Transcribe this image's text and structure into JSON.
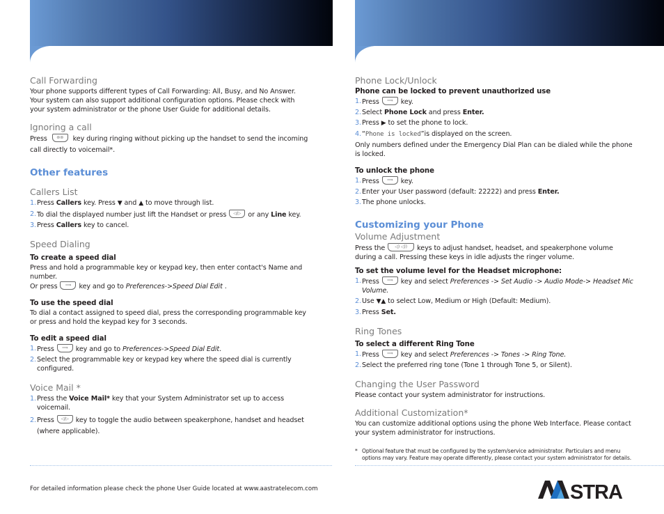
{
  "left_page": {
    "call_forwarding": {
      "heading": "Call Forwarding",
      "body": "Your phone supports different types of Call Forwarding: All, Busy, and No Answer. Your system can also support additional configuration options. Please check with your system administrator or the phone User Guide for additional details."
    },
    "ignoring_call": {
      "heading": "Ignoring a call",
      "pre": "Press",
      "post": "key during ringing without picking up the handset to send  the incoming call directly to voicemail*.",
      "key_icon": "voicemail-key-icon"
    },
    "other_features": {
      "title": "Other features",
      "callers_list": {
        "heading": "Callers List",
        "items": [
          {
            "num": "1.",
            "a": "Press ",
            "b": "Callers",
            "c": " key. Press ",
            "d": " and ",
            "e": " to move through list.",
            "down": "▼",
            "up": "▲"
          },
          {
            "num": "2.",
            "a": "To dial the displayed number just lift the Handset or press",
            "b": "or any ",
            "c": "Line",
            "d": " key."
          },
          {
            "num": "3.",
            "a": "Press ",
            "b": "Callers",
            "c": " key to cancel."
          }
        ]
      },
      "speed_dialing": {
        "heading": "Speed Dialing",
        "create": {
          "title": "To create a speed dial",
          "body": "Press and hold a programmable key or keypad key, then enter contact's Name and number.",
          "or_pre": "Or press",
          "or_mid": "key and go to ",
          "or_path": "Preferences->Speed Dial Edit",
          "or_end": " ."
        },
        "use": {
          "title": "To use the speed dial",
          "body": "To dial a contact assigned to speed dial, press the corresponding programmable key or press and hold the keypad key for 3 seconds."
        },
        "edit": {
          "title": "To edit a speed dial",
          "items": [
            {
              "num": "1.",
              "a": "Press",
              "b": "key and go to ",
              "c": "Preferences->Speed Dial Edit",
              "d": "."
            },
            {
              "num": "2.",
              "a": "Select the programmable key or  keypad key where the speed dial is currently configured."
            }
          ]
        }
      },
      "voice_mail": {
        "heading": "Voice Mail *",
        "items": [
          {
            "num": "1.",
            "a": "Press the ",
            "b": "Voice Mail*",
            "c": " key that your System Administrator set up to access voicemail."
          },
          {
            "num": "2.",
            "a": "Press",
            "b": "key to toggle the audio between speakerphone, handset and headset (where applicable)."
          }
        ]
      }
    },
    "footer": "For detailed information please check the phone User Guide located at www.aastratelecom.com"
  },
  "right_page": {
    "phone_lock": {
      "heading": "Phone Lock/Unlock",
      "lock_title": "Phone can be locked to prevent unauthorized use",
      "lock_items": [
        {
          "num": "1.",
          "a": "Press",
          "b": "key."
        },
        {
          "num": "2.",
          "a": "Select ",
          "b": "Phone Lock",
          "c": " and press ",
          "d": "Enter."
        },
        {
          "num": "3.",
          "a": "Press ",
          "b": "▶",
          "c": " to set the phone to lock."
        },
        {
          "num": "4.",
          "a": "“",
          "b": "Phone is locked",
          "c": "”is displayed on the screen."
        }
      ],
      "note": "Only numbers defined under the Emergency Dial Plan can be dialed while the phone is locked.",
      "unlock_title": "To unlock the phone",
      "unlock_items": [
        {
          "num": "1.",
          "a": "Press",
          "b": "key."
        },
        {
          "num": "2.",
          "a": "Enter your User password (default: 22222) and press ",
          "b": "Enter."
        },
        {
          "num": "3.",
          "a": "The phone unlocks."
        }
      ]
    },
    "customizing": {
      "title": "Customizing your Phone",
      "volume": {
        "heading": "Volume Adjustment",
        "pre": "Press the",
        "post": "keys to adjust handset, headset, and speakerphone volume during a call. Pressing these keys in idle adjusts the ringer volume.",
        "headset_title": "To set the volume level for the Headset microphone:",
        "items": [
          {
            "num": "1.",
            "a": "Press",
            "b": "key and select ",
            "c": "Preferences -> Set Audio -> Audio Mode-> Headset Mic Volume."
          },
          {
            "num": "2.",
            "a": "Use ",
            "b": "▼▲",
            "c": " to select Low, Medium or High (Default: Medium)."
          },
          {
            "num": "3.",
            "a": "Press ",
            "b": "Set."
          }
        ]
      },
      "ring_tones": {
        "heading": "Ring Tones",
        "title": "To select a different Ring Tone",
        "items": [
          {
            "num": "1.",
            "a": "Press",
            "b": "key and select ",
            "c": "Preferences -> Tones -> Ring Tone."
          },
          {
            "num": "2.",
            "a": "Select the preferred ring tone (Tone 1 through Tone 5, or Silent)."
          }
        ]
      },
      "password": {
        "heading": "Changing the User Password",
        "body": "Please contact your system administrator for instructions."
      },
      "additional": {
        "heading": "Additional Customization*",
        "body": "You can customize additional options using the phone Web Interface. Please contact your system administrator for instructions."
      },
      "footnote_star": "*",
      "footnote": "Optional feature that must be configured by the system/service administrator. Particulars and menu options may vary. Feature may operate differently, please contact your system administrator for details."
    },
    "logo": {
      "text": "AASTRA",
      "colors": {
        "dark": "#231f20",
        "blue": "#1d6fc1",
        "light_blue": "#4fa3e0"
      }
    }
  },
  "colors": {
    "accent": "#5b8ed6",
    "subhead": "#7a7a7a",
    "banner_start": "#6b9ad4",
    "banner_end": "#02050c"
  }
}
